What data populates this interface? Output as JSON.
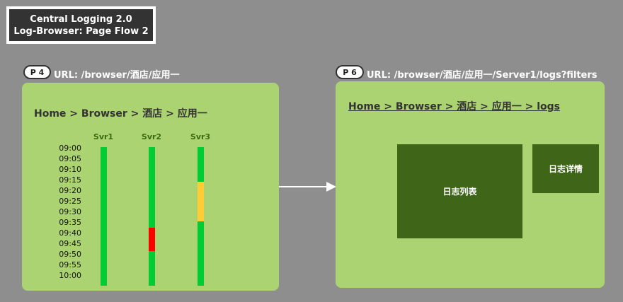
{
  "title": {
    "line1": "Central Logging 2.0",
    "line2": "Log-Browser: Page Flow 2"
  },
  "pages": [
    {
      "badge": "P 4",
      "url": "URL: /browser/酒店/应用一",
      "breadcrumb": "Home > Browser > 酒店 > 应用一",
      "servers": [
        "Svr1",
        "Svr2",
        "Svr3"
      ],
      "times": [
        "09:00",
        "09:05",
        "09:10",
        "09:15",
        "09:20",
        "09:25",
        "09:30",
        "09:35",
        "09:40",
        "09:45",
        "09:50",
        "09:55",
        "10:00"
      ],
      "status_colors": {
        "ok": "#00cc33",
        "warn": "#ffcc33",
        "error": "#ff0000"
      },
      "server_status": [
        {
          "server": "Svr1",
          "segments": [
            {
              "from": "09:00",
              "to": "10:00",
              "status": "ok"
            }
          ]
        },
        {
          "server": "Svr2",
          "segments": [
            {
              "from": "09:00",
              "to": "09:35",
              "status": "ok"
            },
            {
              "from": "09:35",
              "to": "09:45",
              "status": "error"
            },
            {
              "from": "09:45",
              "to": "10:00",
              "status": "ok"
            }
          ]
        },
        {
          "server": "Svr3",
          "segments": [
            {
              "from": "09:00",
              "to": "09:15",
              "status": "ok"
            },
            {
              "from": "09:15",
              "to": "09:32",
              "status": "warn"
            },
            {
              "from": "09:32",
              "to": "10:00",
              "status": "ok"
            }
          ]
        }
      ]
    },
    {
      "badge": "P 6",
      "url": "URL: /browser/酒店/应用一/Server1/logs?filters",
      "breadcrumb": "Home > Browser > 酒店 > 应用一 > logs",
      "log_list_label": "日志列表",
      "log_detail_label": "日志详情"
    }
  ]
}
